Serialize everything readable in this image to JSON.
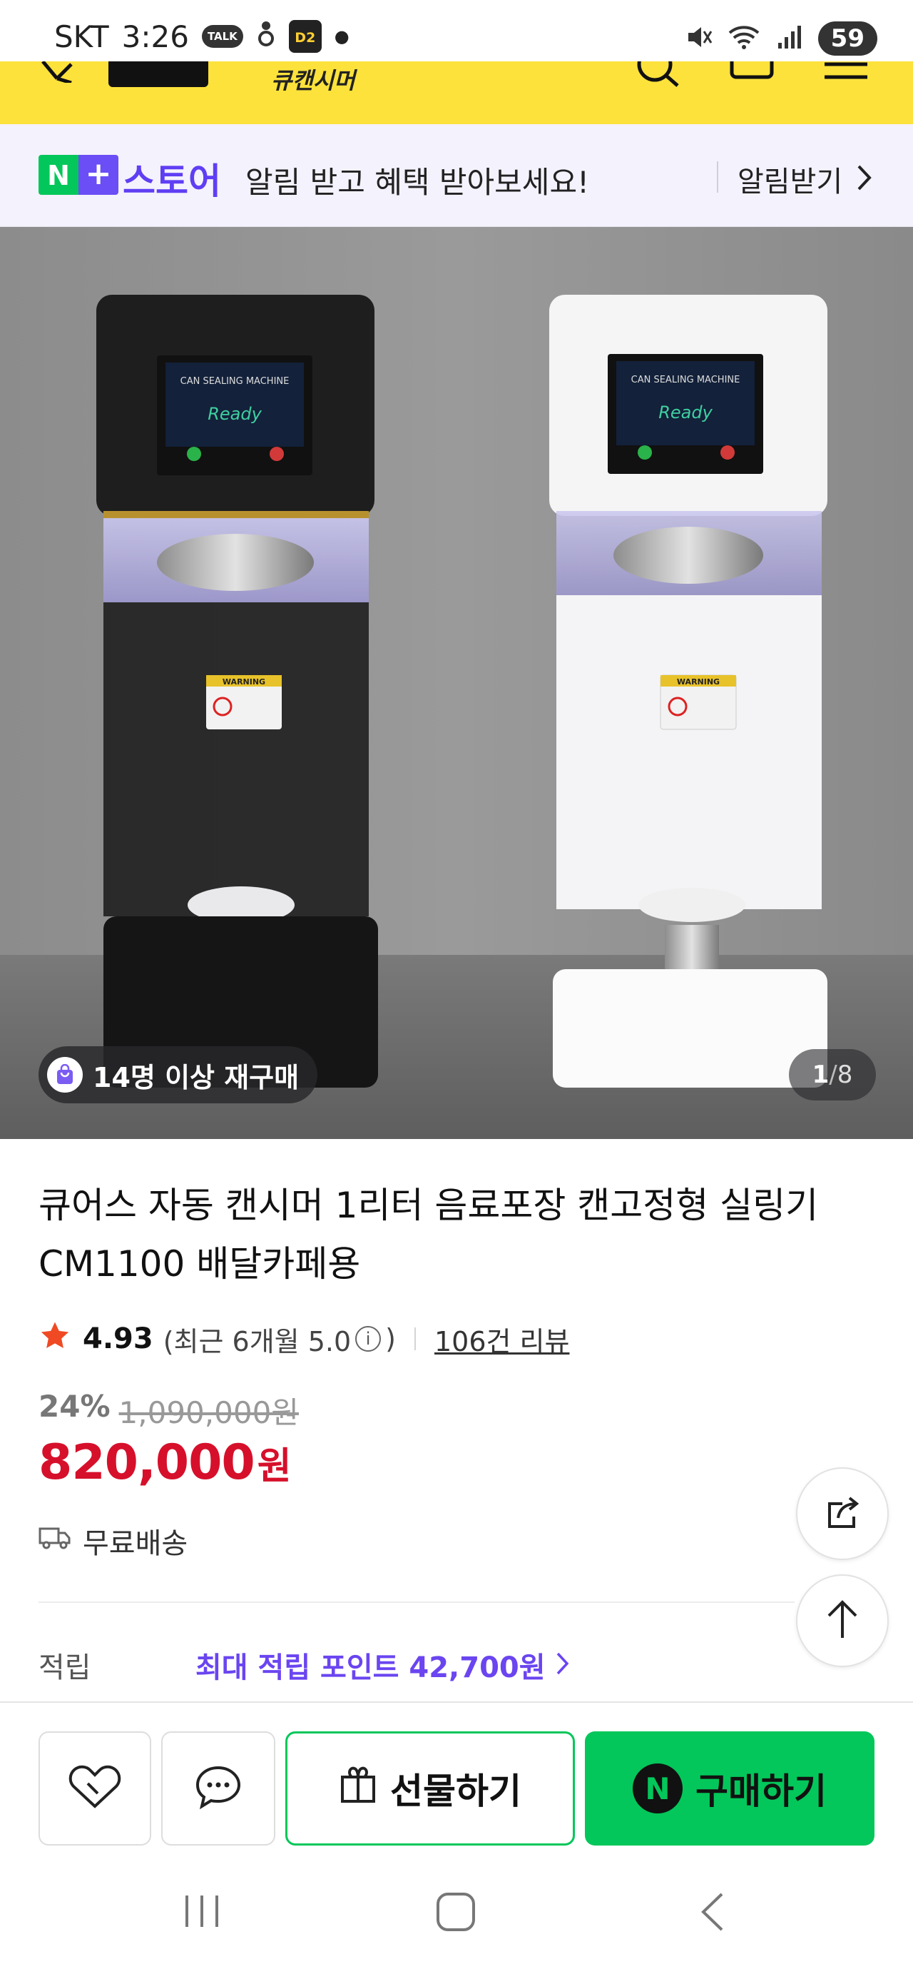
{
  "status_bar": {
    "carrier": "SKT",
    "time": "3:26",
    "talk_badge": "TALK",
    "d2_badge": "D2",
    "battery": "59"
  },
  "app_header": {
    "brand": "큐캔시머"
  },
  "store_banner": {
    "store_name": "스토어",
    "message": "알림 받고 혜택 받아보세요!",
    "alarm_label": "알림받기"
  },
  "product_image": {
    "repurchase_badge": "14명 이상 재구매",
    "page_current": "1",
    "page_separator": "/",
    "page_total": "8",
    "machine_screen_title": "CAN SEALING MACHINE",
    "machine_screen_text": "Ready",
    "warning_label": "WARNING"
  },
  "product": {
    "title": "큐어스 자동 캔시머 1리터 음료포장 캔고정형 실링기 CM1100 배달카페용",
    "rating_score": "4.93",
    "rating_recent_open": "(최근 6개월 5.0",
    "rating_recent_close": ")",
    "review_count": "106건 리뷰",
    "discount_percent": "24%",
    "original_price": "1,090,000원",
    "price": "820,000",
    "price_unit": "원",
    "shipping": "무료배송",
    "points_label": "적립",
    "points_value": "최대 적립 포인트 42,700원"
  },
  "action_bar": {
    "gift_label": "선물하기",
    "buy_label": "구매하기",
    "npay_mark": "N"
  },
  "colors": {
    "header_yellow": "#fde23b",
    "naver_green": "#03c75a",
    "store_purple": "#5f3ef3",
    "price_red": "#d6102b",
    "points_purple": "#6a45f0"
  }
}
